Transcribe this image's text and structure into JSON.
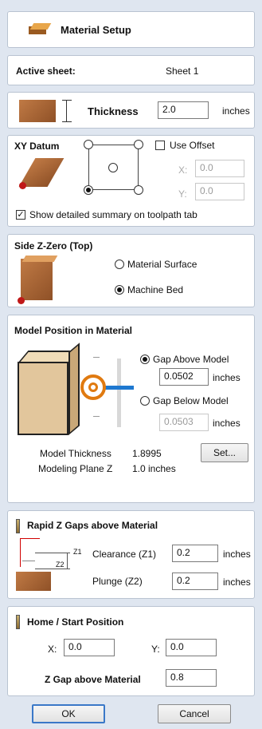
{
  "title": {
    "label": "Material Setup"
  },
  "active_sheet": {
    "label": "Active sheet:",
    "value": "Sheet 1"
  },
  "thickness": {
    "label": "Thickness",
    "value": "2.0",
    "unit": "inches"
  },
  "xy_datum": {
    "title": "XY Datum",
    "use_offset_label": "Use Offset",
    "x_label": "X:",
    "x_value": "0.0",
    "y_label": "Y:",
    "y_value": "0.0",
    "summary_label": "Show detailed summary on toolpath tab",
    "summary_checked": true
  },
  "side_z_zero": {
    "title": "Side Z-Zero (Top)",
    "material_surface_label": "Material Surface",
    "machine_bed_label": "Machine Bed",
    "selected": "Machine Bed"
  },
  "model_position": {
    "title": "Model Position in Material",
    "gap_above_label": "Gap Above Model",
    "gap_above_value": "0.0502",
    "gap_below_label": "Gap Below Model",
    "gap_below_value": "0.0503",
    "unit": "inches",
    "model_thickness_label": "Model Thickness",
    "model_thickness_value": "1.8995",
    "modeling_plane_label": "Modeling Plane Z",
    "modeling_plane_value": "1.0 inches",
    "set_button": "Set...",
    "slider_position": 0.5
  },
  "rapid_z": {
    "title": "Rapid Z Gaps above Material",
    "z1_tag": "Z1",
    "z2_tag": "Z2",
    "clearance_label": "Clearance (Z1)",
    "clearance_value": "0.2",
    "plunge_label": "Plunge (Z2)",
    "plunge_value": "0.2",
    "unit": "inches"
  },
  "home": {
    "title": "Home / Start Position",
    "x_label": "X:",
    "x_value": "0.0",
    "y_label": "Y:",
    "y_value": "0.0",
    "zgap_label": "Z Gap above Material",
    "zgap_value": "0.8"
  },
  "footer": {
    "ok": "OK",
    "cancel": "Cancel"
  },
  "colors": {
    "accent": "#3a78c8",
    "wood": "#b06a36",
    "marker": "#e07a10",
    "handle": "#1e78d0"
  }
}
